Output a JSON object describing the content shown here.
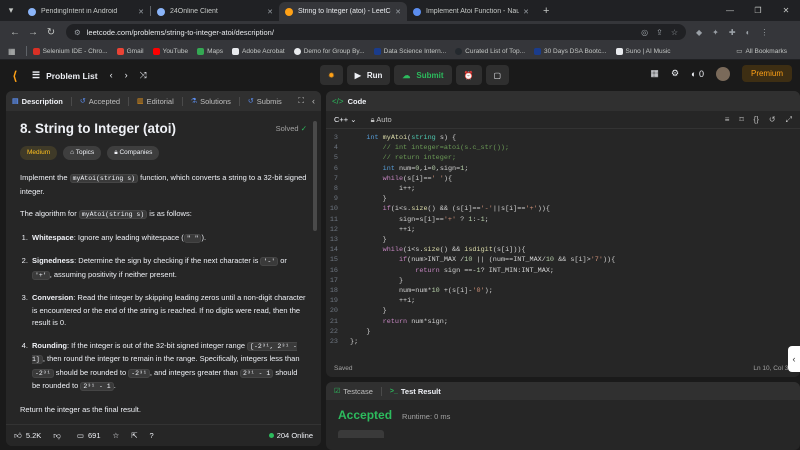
{
  "browser": {
    "tabs": [
      {
        "title": "PendingIntent in Android",
        "color": "#8ab4f8",
        "active": false
      },
      {
        "title": "24Online Client",
        "color": "#8ab4f8",
        "active": false
      },
      {
        "title": "String to Integer (atoi) - LeetCo",
        "color": "#ffa116",
        "active": true
      },
      {
        "title": "Implement Atoi Function - Nau",
        "color": "#5b8def",
        "active": false
      }
    ],
    "url": "leetcode.com/problems/string-to-integer-atoi/description/",
    "bookmarks": [
      "Selenium IDE - Chro...",
      "Gmail",
      "YouTube",
      "Maps",
      "Adobe Acrobat",
      "Demo for Group By...",
      "Data Science Intern...",
      "Curated List of Top...",
      "30 Days DSA Bootc...",
      "Suno | AI Music"
    ],
    "all_bookmarks": "All Bookmarks"
  },
  "header": {
    "problem_list": "Problem List",
    "run": "Run",
    "submit": "Submit",
    "streak": "0",
    "premium": "Premium"
  },
  "desc_tabs": [
    {
      "label": "Description",
      "icon": "▤"
    },
    {
      "label": "Accepted",
      "icon": "↺"
    },
    {
      "label": "Editorial",
      "icon": "▥"
    },
    {
      "label": "Solutions",
      "icon": "⚗"
    },
    {
      "label": "Submis",
      "icon": "↺"
    }
  ],
  "problem": {
    "title": "8. String to Integer (atoi)",
    "solved": "Solved",
    "difficulty": "Medium",
    "topics": "Topics",
    "companies": "Companies",
    "p1a": "Implement the ",
    "p1code": "myAtoi(string s)",
    "p1b": " function, which converts a string to a 32-bit signed integer.",
    "p2a": "The algorithm for ",
    "p2code": "myAtoi(string s)",
    "p2b": " is as follows:",
    "s1title": "Whitespace",
    "s1a": ": Ignore any leading whitespace (",
    "s1code": "\" \"",
    "s1b": ").",
    "s2title": "Signedness",
    "s2a": ": Determine the sign by checking if the next character is ",
    "s2code1": "'-'",
    "s2b": " or ",
    "s2code2": "'+'",
    "s2c": ", assuming positivity if neither present.",
    "s3title": "Conversion",
    "s3a": ": Read the integer by skipping leading zeros until a non-digit character is encountered or the end of the string is reached. If no digits were read, then the result is 0.",
    "s4title": "Rounding",
    "s4a": ": If the integer is out of the 32-bit signed integer range ",
    "s4code1": "[-2³¹, 2³¹ - 1]",
    "s4b": ", then round the integer to remain in the range. Specifically, integers less than ",
    "s4code2": "-2³¹",
    "s4c": " should be rounded to ",
    "s4code3": "-2³¹",
    "s4d": ", and integers greater than ",
    "s4code4": "2³¹ - 1",
    "s4e": " should be rounded to ",
    "s4code5": "2³¹ - 1",
    "s4f": ".",
    "final": "Return the integer as the final result."
  },
  "stats": {
    "likes": "5.2K",
    "comments": "691",
    "online": "204 Online"
  },
  "code_panel": {
    "title": "Code",
    "language": "C++",
    "mode": "Auto",
    "saved": "Saved",
    "cursor": "Ln 10, Col 36"
  },
  "code_lines": [
    {
      "n": "3",
      "html": "    <span class='kw'>int</span> <span class='fn'>myAtoi</span>(<span class='ty'>string</span> s) {"
    },
    {
      "n": "4",
      "html": "        <span class='cm'>// int integer=atoi(s.c_str());</span>"
    },
    {
      "n": "5",
      "html": "        <span class='cm'>// return integer;</span>"
    },
    {
      "n": "6",
      "html": "        <span class='kw'>int</span> num=<span class='nm'>0</span>,i=<span class='nm'>0</span>,sign=<span class='nm'>1</span>;"
    },
    {
      "n": "7",
      "html": "        <span class='ctl'>while</span>(s[i]==<span class='st'>' '</span>){"
    },
    {
      "n": "8",
      "html": "            i++;"
    },
    {
      "n": "9",
      "html": "        }"
    },
    {
      "n": "10",
      "html": "        <span class='ctl'>if</span>(i&lt;s.<span class='fn'>size</span>() &amp;&amp; (s[i]==<span class='st'>'-'</span>||s[i]==<span class='st'>'+'</span>)){"
    },
    {
      "n": "11",
      "html": "            sign=s[i]==<span class='st'>'+'</span> ? <span class='nm'>1</span>:-<span class='nm'>1</span>;"
    },
    {
      "n": "12",
      "html": "            ++i;"
    },
    {
      "n": "13",
      "html": "        }"
    },
    {
      "n": "14",
      "html": "        <span class='ctl'>while</span>(i&lt;s.<span class='fn'>size</span>() &amp;&amp; <span class='fn'>isdigit</span>(s[i])){"
    },
    {
      "n": "15",
      "html": "            <span class='ctl'>if</span>(num&gt;INT_MAX /<span class='nm'>10</span> || (num==INT_MAX/<span class='nm'>10</span> &amp;&amp; s[i]&gt;<span class='st'>'7'</span>)){"
    },
    {
      "n": "16",
      "html": "                <span class='ctl'>return</span> sign ==-<span class='nm'>1</span>? INT_MIN:INT_MAX;"
    },
    {
      "n": "17",
      "html": "            }"
    },
    {
      "n": "18",
      "html": "            num=num*<span class='nm'>10</span> +(s[i]-<span class='st'>'0'</span>);"
    },
    {
      "n": "19",
      "html": "            ++i;"
    },
    {
      "n": "20",
      "html": "        }"
    },
    {
      "n": "21",
      "html": "        <span class='ctl'>return</span> num*sign;"
    },
    {
      "n": "22",
      "html": "    }"
    },
    {
      "n": "23",
      "html": "};"
    }
  ],
  "result": {
    "testcase": "Testcase",
    "test_result": "Test Result",
    "status": "Accepted",
    "runtime": "Runtime: 0 ms"
  }
}
